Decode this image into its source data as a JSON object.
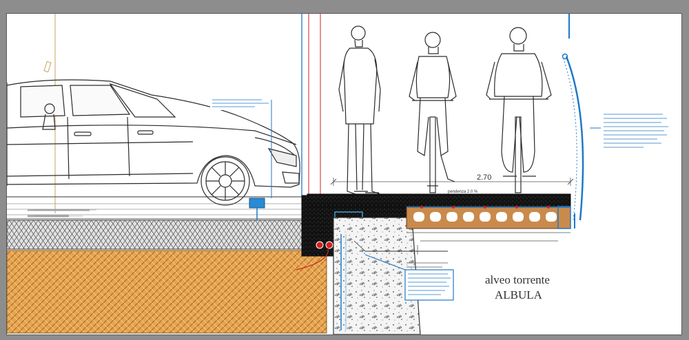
{
  "drawing": {
    "river_label_line1": "alveo torrente",
    "river_label_line2": "ALBULA",
    "dimension_width": "2.70",
    "slope_label": "pendenza 2.0 %"
  },
  "colors": {
    "sheet": "#ffffff",
    "frame": "#8d8d8d",
    "line": "#2a2a2a",
    "note_blue": "#1e78c8",
    "accent_red": "#d42020",
    "gravel": "#d9d9d9",
    "soil": "#e3a24a",
    "brick": "#b87a3d"
  },
  "icons": [
    "car-icon",
    "pedestrian-icon",
    "cyclist-icon",
    "cyclist-rear-icon"
  ]
}
